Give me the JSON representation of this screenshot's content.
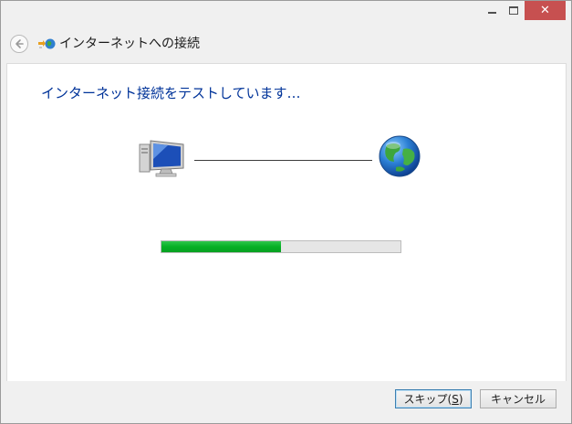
{
  "window": {
    "min_glyph": "─",
    "max_glyph": "□",
    "close_glyph": "✕"
  },
  "header": {
    "title": "インターネットへの接続",
    "back_icon": "back-arrow-icon",
    "app_icon": "network-connection-icon"
  },
  "content": {
    "instruction": "インターネット接続をテストしています…",
    "left_icon": "computer-icon",
    "right_icon": "globe-icon"
  },
  "progress": {
    "value_percent": 50,
    "color": "#06b025"
  },
  "footer": {
    "skip_label": "スキップ(S)",
    "skip_accelerator": "S",
    "cancel_label": "キャンセル"
  },
  "colors": {
    "instruction_text": "#003399",
    "close_button": "#c75050"
  }
}
